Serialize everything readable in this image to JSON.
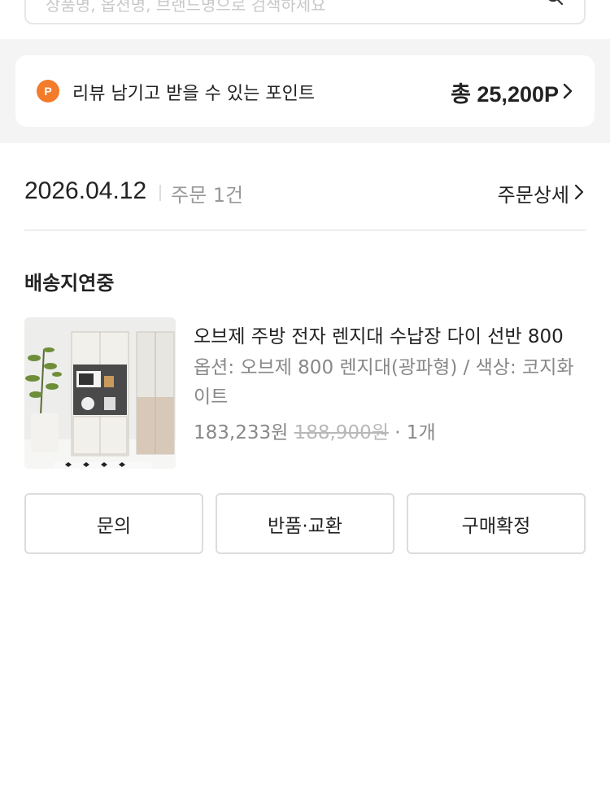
{
  "search": {
    "placeholder": "상품명, 옵션명, 브랜드명으로 검색하세요"
  },
  "points": {
    "badge": "P",
    "label": "리뷰 남기고 받을 수 있는 포인트",
    "total": "총 25,200P",
    "accent_color": "#f47b2a"
  },
  "order": {
    "date": "2026.04.12",
    "count": "주문 1건",
    "detail_link": "주문상세"
  },
  "shipment": {
    "status": "배송지연중"
  },
  "product": {
    "title": "오브제 주방 전자 렌지대 수납장 다이 선반 800",
    "option": "옵션: 오브제 800 렌지대(광파형) / 색상: 코지화이트",
    "price": "183,233원",
    "original_price": "188,900원",
    "quantity": "· 1개"
  },
  "actions": [
    {
      "label": "문의"
    },
    {
      "label": "반품·교환"
    },
    {
      "label": "구매확정"
    }
  ]
}
